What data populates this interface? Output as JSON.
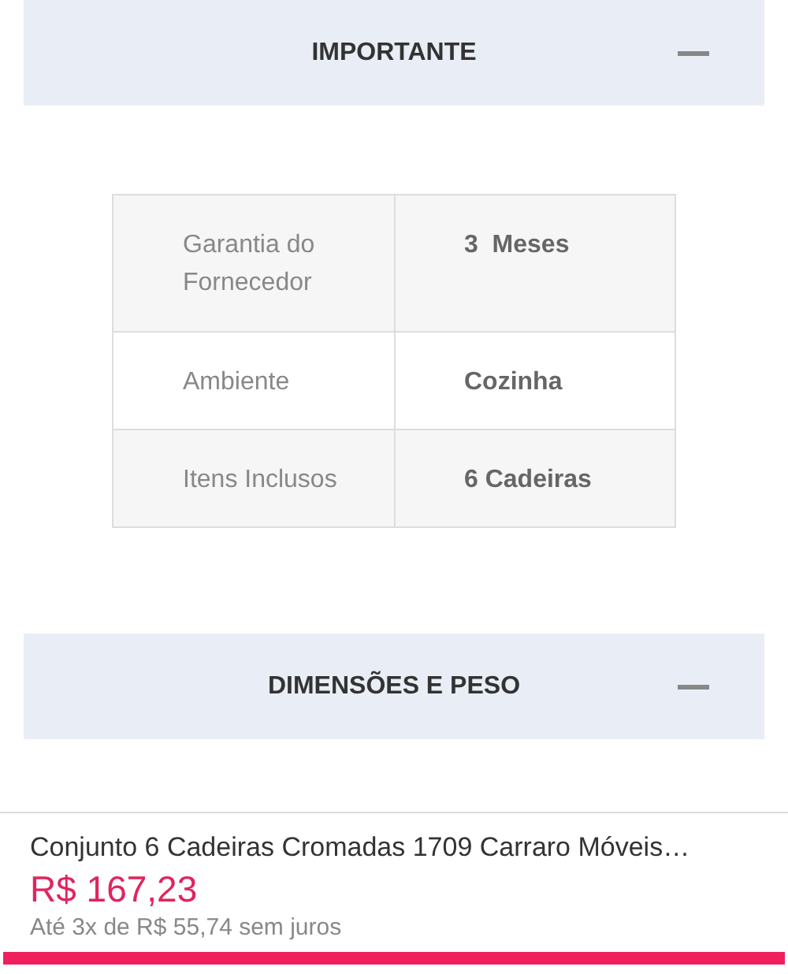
{
  "sections": [
    {
      "title": "IMPORTANTE",
      "expanded": true,
      "specs": [
        {
          "label": "Garantia do Fornecedor",
          "value": "3  Meses"
        },
        {
          "label": "Ambiente",
          "value": "Cozinha"
        },
        {
          "label": "Itens Inclusos",
          "value": "6 Cadeiras"
        }
      ]
    },
    {
      "title": "DIMENSÕES E PESO",
      "expanded": true
    }
  ],
  "product": {
    "name": "Conjunto 6 Cadeiras Cromadas 1709 Carraro Móveis…",
    "price": "R$ 167,23",
    "installments": "Até 3x de R$ 55,74 sem juros"
  }
}
